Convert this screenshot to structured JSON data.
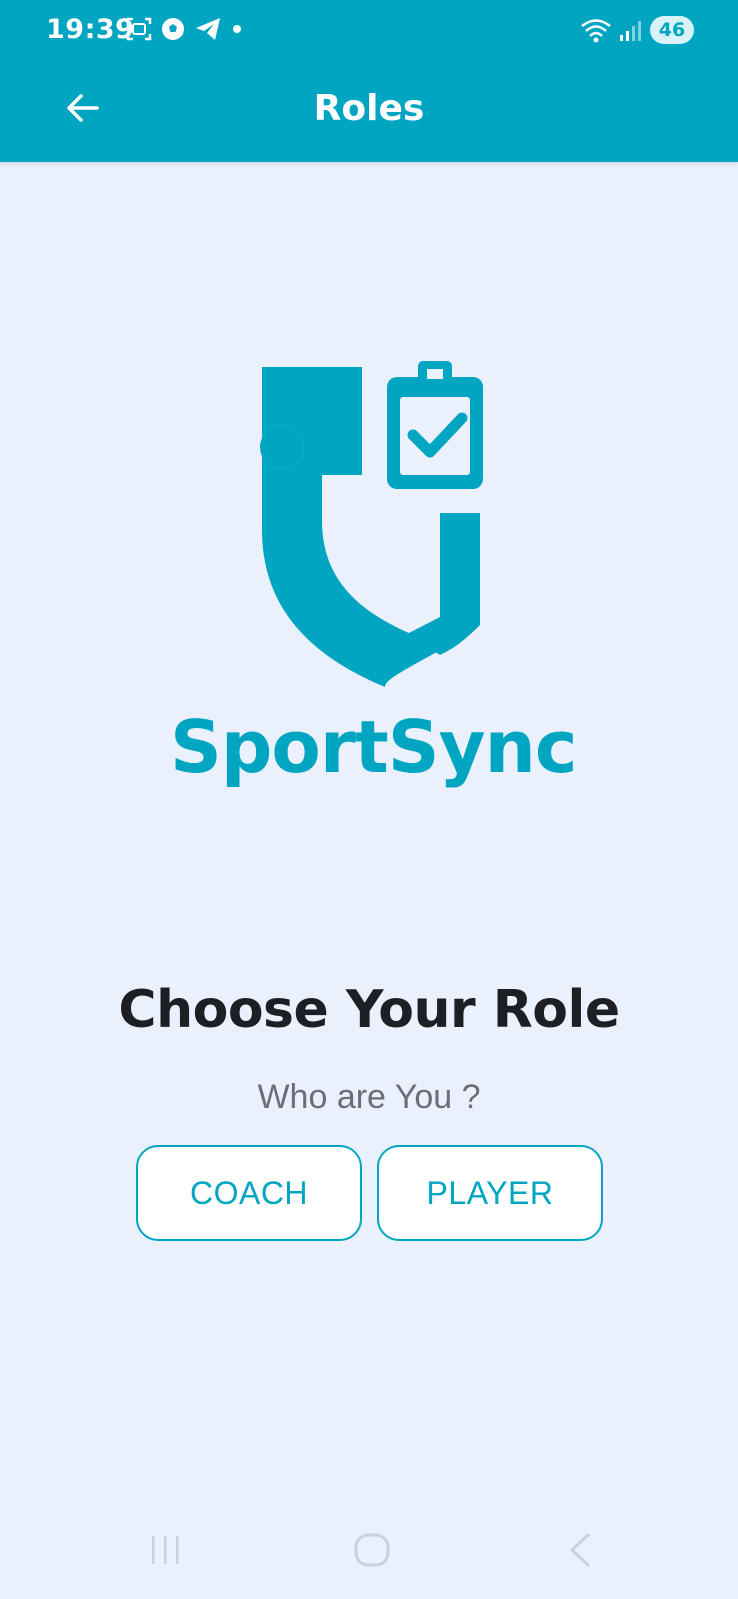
{
  "status_bar": {
    "time": "19:39",
    "battery": "46",
    "icons_left": [
      "screenshot-icon",
      "soccer-ball-icon",
      "telegram-icon",
      "dot-icon"
    ],
    "icons_right": [
      "wifi-icon",
      "signal-icon",
      "battery-icon"
    ]
  },
  "app_bar": {
    "title": "Roles",
    "back_icon": "arrow-left-icon",
    "color": "#00a5c2"
  },
  "logo": {
    "text": "SportSync",
    "icon": "shield-clipboard-logo",
    "color": "#00a5c2"
  },
  "main": {
    "heading": "Choose Your Role",
    "subheading": "Who are You ?",
    "buttons": [
      {
        "label": "COACH"
      },
      {
        "label": "PLAYER"
      }
    ]
  },
  "nav_bar": {
    "items": [
      "recents-icon",
      "home-icon",
      "back-icon"
    ]
  }
}
